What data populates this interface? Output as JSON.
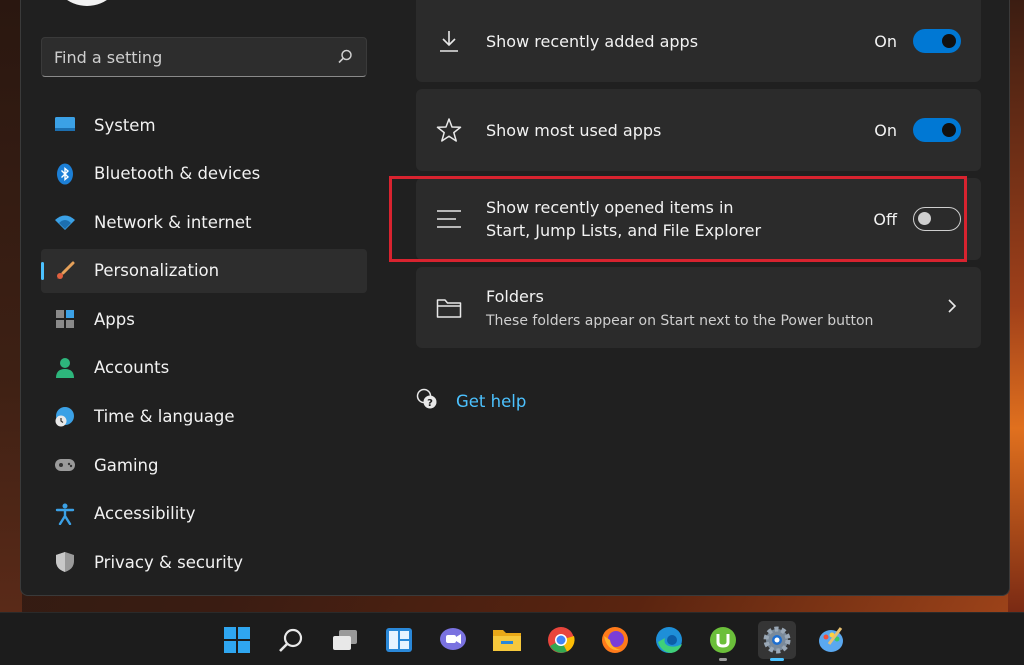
{
  "search": {
    "placeholder": "Find a setting"
  },
  "nav": {
    "items": [
      {
        "label": "System",
        "icon": "monitor-icon"
      },
      {
        "label": "Bluetooth & devices",
        "icon": "bluetooth-icon"
      },
      {
        "label": "Network & internet",
        "icon": "wifi-icon"
      },
      {
        "label": "Personalization",
        "icon": "paintbrush-icon",
        "active": true
      },
      {
        "label": "Apps",
        "icon": "apps-icon"
      },
      {
        "label": "Accounts",
        "icon": "person-icon"
      },
      {
        "label": "Time & language",
        "icon": "globe-clock-icon"
      },
      {
        "label": "Gaming",
        "icon": "gamepad-icon"
      },
      {
        "label": "Accessibility",
        "icon": "accessibility-icon"
      },
      {
        "label": "Privacy & security",
        "icon": "shield-icon"
      }
    ]
  },
  "settings": {
    "recently_added": {
      "label": "Show recently added apps",
      "state": "On"
    },
    "most_used": {
      "label": "Show most used apps",
      "state": "On"
    },
    "recently_opened": {
      "label_line1": "Show recently opened items in",
      "label_line2": "Start, Jump Lists, and File Explorer",
      "state": "Off"
    },
    "folders": {
      "label": "Folders",
      "sub": "These folders appear on Start next to the Power button"
    }
  },
  "help": {
    "label": "Get help"
  },
  "colors": {
    "accent": "#0078d4",
    "link": "#4cc2ff",
    "highlight": "#d8232f",
    "background": "#202020",
    "card": "#2b2b2b"
  },
  "taskbar": {
    "icons": [
      "start-icon",
      "search-icon",
      "task-view-icon",
      "widgets-icon",
      "chat-icon",
      "file-explorer-icon",
      "chrome-icon",
      "firefox-icon",
      "edge-icon",
      "utorrent-icon",
      "settings-icon",
      "paint-icon"
    ]
  }
}
